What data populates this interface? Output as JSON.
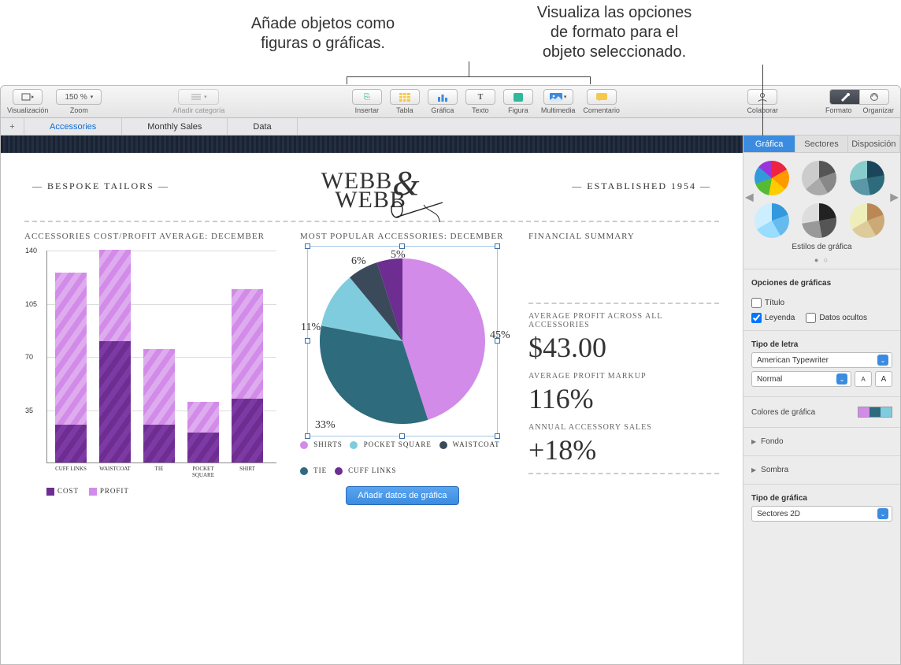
{
  "callouts": {
    "left": "Añade objetos como\nfiguras o gráficas.",
    "right": "Visualiza las opciones\nde formato para el\nobjeto seleccionado."
  },
  "toolbar": {
    "view": "Visualización",
    "zoom_value": "150 %",
    "zoom_label": "Zoom",
    "add_category": "Añadir categoría",
    "insert": "Insertar",
    "table": "Tabla",
    "chart": "Gráfica",
    "text": "Texto",
    "shape": "Figura",
    "media": "Multimedia",
    "comment": "Comentario",
    "collaborate": "Colaborar",
    "format": "Formato",
    "organize": "Organizar"
  },
  "tabs": [
    "Accessories",
    "Monthly Sales",
    "Data"
  ],
  "active_tab": 0,
  "sheet": {
    "left_tag": "— BESPOKE TAILORS —",
    "right_tag": "— ESTABLISHED 1954 —",
    "logo_line1": "WEBB",
    "logo_line2": "WEBB",
    "bar_title": "ACCESSORIES COST/PROFIT AVERAGE: DECEMBER",
    "pie_title": "MOST POPULAR ACCESSORIES: DECEMBER",
    "summary_title": "FINANCIAL SUMMARY",
    "add_chart_data": "Añadir datos de gráfica",
    "bar_legend": {
      "cost": "COST",
      "profit": "PROFIT"
    },
    "pie_legend": [
      "SHIRTS",
      "TIE",
      "POCKET SQUARE",
      "WAISTCOAT",
      "CUFF LINKS"
    ],
    "summary": [
      {
        "label": "AVERAGE PROFIT ACROSS ALL ACCESSORIES",
        "value": "$43.00"
      },
      {
        "label": "AVERAGE PROFIT MARKUP",
        "value": "116%"
      },
      {
        "label": "ANNUAL ACCESSORY SALES",
        "value": "+18%"
      }
    ]
  },
  "chart_data": [
    {
      "type": "bar",
      "title": "ACCESSORIES COST/PROFIT AVERAGE: DECEMBER",
      "categories": [
        "CUFF LINKS",
        "WAISTCOAT",
        "TIE",
        "POCKET SQUARE",
        "SHIRT"
      ],
      "series": [
        {
          "name": "COST",
          "values": [
            25,
            80,
            25,
            20,
            42
          ]
        },
        {
          "name": "PROFIT",
          "values": [
            100,
            60,
            50,
            20,
            72
          ]
        }
      ],
      "ylim": [
        0,
        140
      ],
      "yticks": [
        35,
        70,
        105,
        140
      ],
      "stacked": true,
      "colors": {
        "COST": "#6d2d91",
        "PROFIT": "#d28be8"
      }
    },
    {
      "type": "pie",
      "title": "MOST POPULAR ACCESSORIES: DECEMBER",
      "categories": [
        "SHIRTS",
        "WAISTCOAT",
        "TIE",
        "POCKET SQUARE",
        "CUFF LINKS"
      ],
      "values": [
        45,
        33,
        11,
        6,
        5
      ],
      "colors": [
        "#d28be8",
        "#2e6b7d",
        "#7fccde",
        "#3b4a5a",
        "#6d2d91"
      ],
      "labels": [
        "45%",
        "33%",
        "11%",
        "6%",
        "5%"
      ]
    }
  ],
  "inspector": {
    "tabs": [
      "Gráfica",
      "Sectores",
      "Disposición"
    ],
    "active": 0,
    "styles_title": "Estilos de gráfica",
    "options_header": "Opciones de gráficas",
    "title_cb": "Título",
    "legend_cb": "Leyenda",
    "hidden_cb": "Datos ocultos",
    "font_header": "Tipo de letra",
    "font_value": "American Typewriter",
    "font_style": "Normal",
    "colors_header": "Colores de gráfica",
    "bg_header": "Fondo",
    "shadow_header": "Sombra",
    "chart_type_header": "Tipo de gráfica",
    "chart_type_value": "Sectores 2D"
  }
}
